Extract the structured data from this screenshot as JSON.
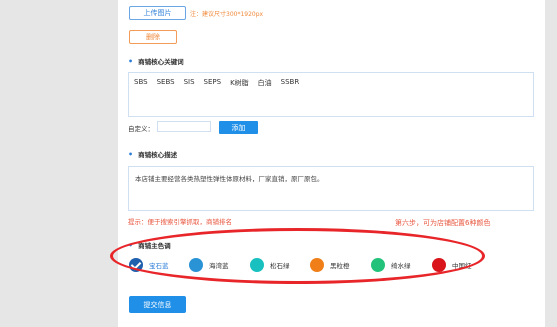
{
  "upload": {
    "button_label": "上传图片",
    "note": "注：建议尺寸300*1920px",
    "delete_label": "删除"
  },
  "keywords": {
    "title": "商铺核心关键词",
    "items": [
      "SBS",
      "SEBS",
      "SIS",
      "SEPS",
      "K树脂",
      "白油",
      "SSBR"
    ],
    "custom_label": "自定义：",
    "custom_value": "",
    "add_label": "添加"
  },
  "description": {
    "title": "商铺核心描述",
    "text": "本店铺主要经营各类热塑性弹性体原材料，厂家直销，原厂原包。",
    "tip": "提示：便于搜索引擎抓取，商铺排名"
  },
  "annotation": "第六步，可为店铺配置6种颜色",
  "theme": {
    "title": "商铺主色调",
    "colors": [
      {
        "label": "宝石蓝",
        "color": "#1e5fae",
        "selected": true
      },
      {
        "label": "海湾蓝",
        "color": "#2a93d6",
        "selected": false
      },
      {
        "label": "松石绿",
        "color": "#18c1c0",
        "selected": false
      },
      {
        "label": "黑粒橙",
        "color": "#f07f1a",
        "selected": false
      },
      {
        "label": "绮水绿",
        "color": "#22c27a",
        "selected": false
      },
      {
        "label": "中国红",
        "color": "#d9141b",
        "selected": false
      }
    ]
  },
  "submit_label": "提交信息"
}
